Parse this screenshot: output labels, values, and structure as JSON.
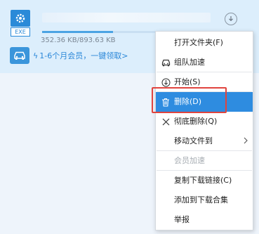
{
  "item": {
    "file_type": "EXE",
    "size_text": "352.36 KB/893.63 KB",
    "progress_fraction": 0.39,
    "promo_text": "1-6个月会员，一键领取>",
    "accent": "#2a8ad8"
  },
  "menu": {
    "items": [
      {
        "label": "打开文件夹(F)",
        "icon": "none"
      },
      {
        "label": "组队加速",
        "icon": "car-icon"
      },
      {
        "label": "开始(S)",
        "icon": "download-icon"
      },
      {
        "label": "删除(D)",
        "icon": "trash-icon",
        "selected": true
      },
      {
        "label": "彻底删除(Q)",
        "icon": "close-icon"
      },
      {
        "label": "移动文件到",
        "icon": "none",
        "submenu": true
      },
      {
        "label": "会员加速",
        "icon": "none",
        "disabled": true
      },
      {
        "label": "复制下载链接(C)",
        "icon": "none"
      },
      {
        "label": "添加到下载合集",
        "icon": "none"
      },
      {
        "label": "举报",
        "icon": "none"
      }
    ],
    "selected_color": "#2e8ce0",
    "highlight_color": "#e0443e"
  }
}
